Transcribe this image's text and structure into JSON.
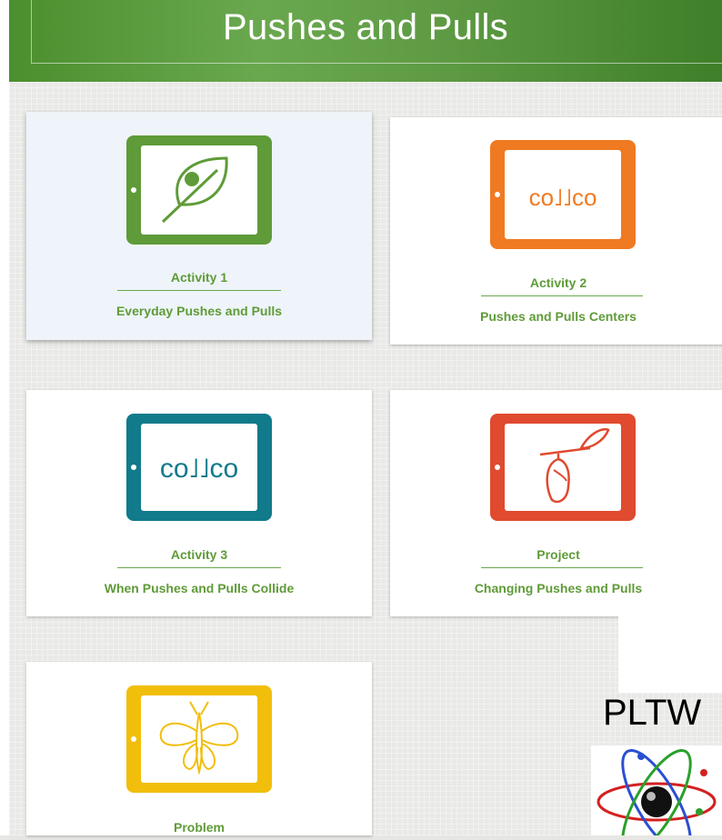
{
  "header": {
    "title": "Pushes and Pulls"
  },
  "cards": [
    {
      "heading": "Activity 1",
      "subtitle": "Everyday Pushes and Pulls",
      "icon": "leaf-tablet-icon",
      "color": "#5f9b38"
    },
    {
      "heading": "Activity 2",
      "subtitle": "Pushes and Pulls Centers",
      "icon": "caterpillar-tablet-icon",
      "color": "#f07a22"
    },
    {
      "heading": "Activity 3",
      "subtitle": "When Pushes and Pulls Collide",
      "icon": "caterpillar-tablet-icon",
      "color": "#117a8b"
    },
    {
      "heading": "Project",
      "subtitle": "Changing Pushes and Pulls",
      "icon": "chrysalis-tablet-icon",
      "color": "#e04a2f"
    },
    {
      "heading": "Problem",
      "subtitle": "",
      "icon": "butterfly-tablet-icon",
      "color": "#f2be0c"
    }
  ],
  "logo": {
    "text": "PLTW",
    "icon": "atom-icon"
  }
}
